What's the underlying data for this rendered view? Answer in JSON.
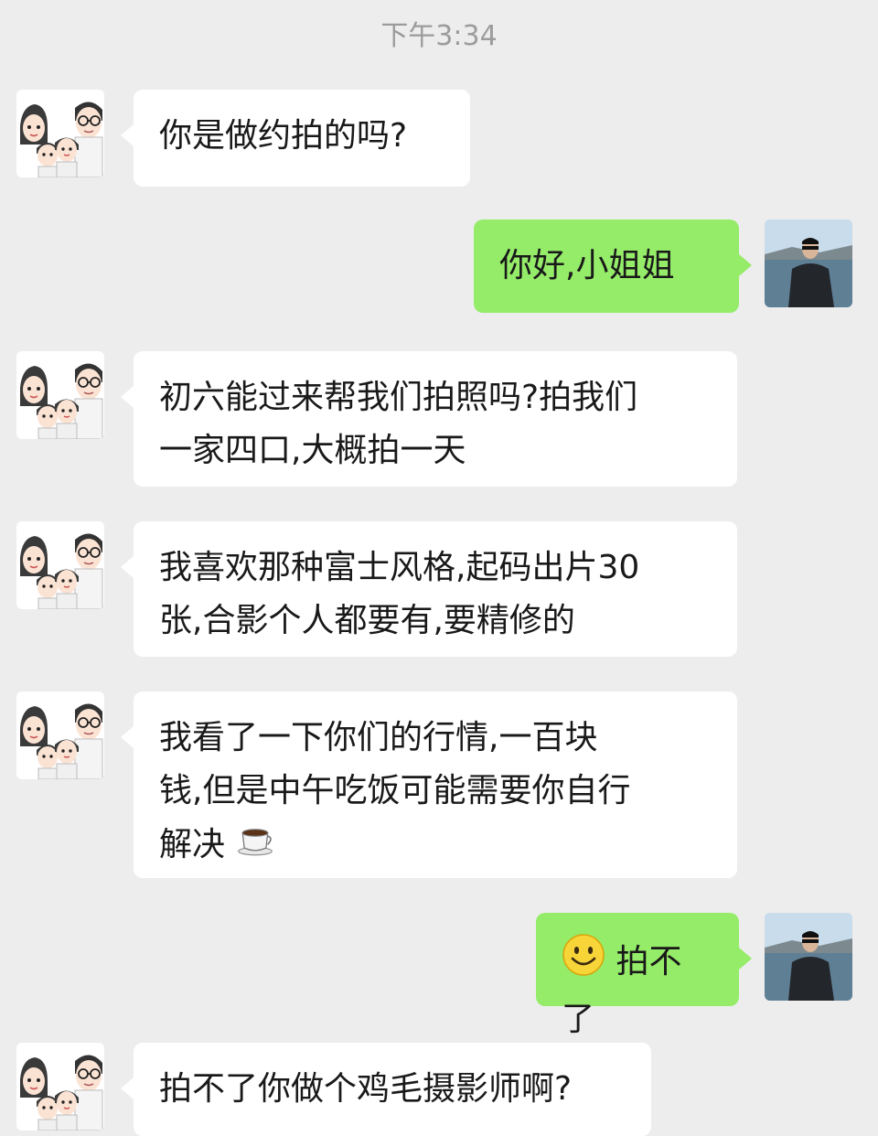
{
  "timestamp": "下午3:34",
  "colors": {
    "background": "#ededed",
    "incoming_bubble": "#ffffff",
    "outgoing_bubble": "#95ec69",
    "timestamp_text": "#9c9c9c"
  },
  "messages": [
    {
      "side": "left",
      "avatar": "family-avatar-icon",
      "text": "你是做约拍的吗?"
    },
    {
      "side": "right",
      "avatar": "user-photo-avatar",
      "text": "你好,小姐姐"
    },
    {
      "side": "left",
      "avatar": "family-avatar-icon",
      "lines": [
        "初六能过来帮我们拍照吗?拍我们",
        "一家四口,大概拍一天"
      ]
    },
    {
      "side": "left",
      "avatar": "family-avatar-icon",
      "lines": [
        "我喜欢那种富士风格,起码出片30",
        "张,合影个人都要有,要精修的"
      ]
    },
    {
      "side": "left",
      "avatar": "family-avatar-icon",
      "lines": [
        "我看了一下你们的行情,一百块",
        "钱,但是中午吃饭可能需要你自行",
        "解决"
      ],
      "trailing_emoji": "coffee-emoji-icon"
    },
    {
      "side": "right",
      "avatar": "user-photo-avatar",
      "leading_emoji": "smile-emoji-icon",
      "text": "拍不了"
    },
    {
      "side": "left",
      "avatar": "family-avatar-icon",
      "text": "拍不了你做个鸡毛摄影师啊?"
    }
  ]
}
